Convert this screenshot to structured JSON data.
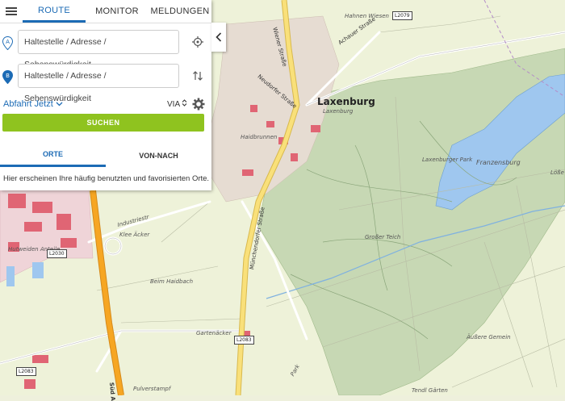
{
  "tabs": [
    {
      "label": "ROUTE",
      "active": true
    },
    {
      "label": "MONITOR",
      "active": false
    },
    {
      "label": "MELDUNGEN",
      "active": false
    }
  ],
  "from": {
    "placeholder": "Haltestelle / Adresse / Sehenswürdigkeit",
    "marker": "A"
  },
  "to": {
    "placeholder": "Haltestelle / Adresse / Sehenswürdigkeit",
    "marker": "B"
  },
  "departure": {
    "label": "Abfahrt Jetzt"
  },
  "via": {
    "label": "VIA"
  },
  "search_button": "SUCHEN",
  "subtabs": [
    {
      "label": "ORTE",
      "active": true
    },
    {
      "label": "VON-NACH",
      "active": false
    }
  ],
  "hint": "Hier erscheinen Ihre häufig benutzten und favorisierten Orte.",
  "colors": {
    "accent": "#1c6bb5",
    "search": "#8fc31f",
    "highway": "#f6a623",
    "main_road": "#f9e07a",
    "water": "#9fc7ef",
    "forest": "#c5d6b0"
  },
  "map": {
    "town": "Laxenburg",
    "labels": {
      "hahnen_wiesen": "Hahnen Wiesen",
      "laxenburg_small": "Laxenburg",
      "laxenburger_park": "Laxenburger Park",
      "franzensburg": "Franzensburg",
      "grosser_teich": "Großer Teich",
      "beim_haidbach": "Beim Haidbach",
      "gartenacker": "Gartenäcker",
      "aussere_gemein": "Äußere Gemein",
      "tendl_garten": "Tendl Gärten",
      "pulverstampf": "Pulverstampf",
      "kleeacker": "Klee Äcker",
      "industrie": "Industriestr",
      "hutweiden": "Hutweiden Anteile",
      "park": "Park",
      "loss": "Löße",
      "haidbrunnen": "Haidbrunnen"
    },
    "roads": {
      "wiener": "Wiener Straße",
      "achauer": "Achauer Straße",
      "muench": "Münchendorfer Straße",
      "neudorfer": "Neudorfer Straße",
      "sud": "Süd A"
    },
    "road_tags": {
      "l2079": "L2079",
      "l2030": "L2030",
      "l2083a": "L2083",
      "l2083b": "L2083"
    }
  }
}
